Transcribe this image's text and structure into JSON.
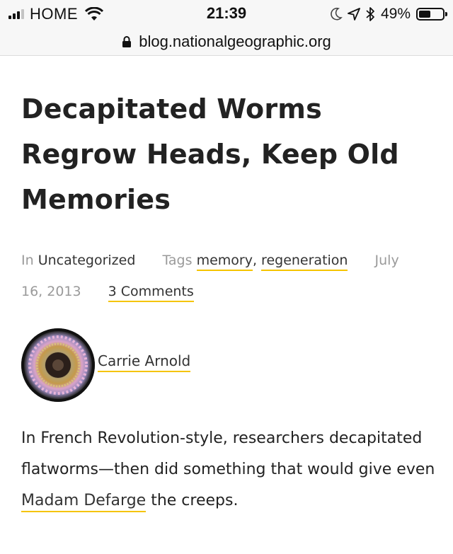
{
  "status_bar": {
    "carrier": "HOME",
    "time": "21:39",
    "battery": "49%",
    "battery_level": 0.49,
    "icons": [
      "signal-bars-icon",
      "wifi-icon",
      "moon-icon",
      "location-arrow-icon",
      "bluetooth-icon",
      "battery-icon"
    ]
  },
  "browser": {
    "url": "blog.nationalgeographic.org",
    "lock_icon": "lock-icon"
  },
  "article": {
    "title_lines": [
      "Decapitated Worms",
      "Regrow Heads, Keep Old",
      "Memories"
    ],
    "meta": {
      "in_label": "In",
      "category": "Uncategorized",
      "tags_label": "Tags",
      "tag1": "memory",
      "tag_sep": ",",
      "tag2": "regeneration",
      "date_part1": "July",
      "date_part2": "16, 2013",
      "comments": "3 Comments"
    },
    "author": {
      "name": "Carrie Arnold"
    },
    "body": {
      "text_before_link": "In French Revolution-style, researchers decapitated flatworms—then did something that would give even ",
      "link": "Madam Defarge",
      "text_after_link": " the creeps."
    }
  },
  "colors": {
    "link_underline": "#f5c400",
    "meta_gray": "#9a9a9a",
    "title": "#222222",
    "browser_bar": "#f7f7f7"
  }
}
